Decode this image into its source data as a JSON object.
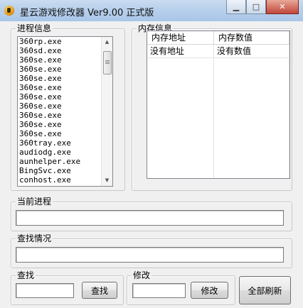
{
  "window": {
    "title": "星云游戏修改器 Ver9.00 正式版"
  },
  "process_group": {
    "title": "进程信息",
    "items": [
      "360rp.exe",
      "360sd.exe",
      "360se.exe",
      "360se.exe",
      "360se.exe",
      "360se.exe",
      "360se.exe",
      "360se.exe",
      "360se.exe",
      "360se.exe",
      "360se.exe",
      "360tray.exe",
      "audiodg.exe",
      "aunhelper.exe",
      "BingSvc.exe",
      "conhost.exe"
    ]
  },
  "memory_group": {
    "title": "内存信息",
    "columns": [
      "内存地址",
      "内存数值"
    ],
    "rows": [
      [
        "没有地址",
        "没有数值"
      ]
    ]
  },
  "current_process": {
    "title": "当前进程",
    "value": ""
  },
  "search_status": {
    "title": "查找情况",
    "value": ""
  },
  "search": {
    "title": "查找",
    "value": "",
    "button": "查找"
  },
  "modify": {
    "title": "修改",
    "value": "",
    "button": "修改"
  },
  "refresh_button": "全部刷新"
}
